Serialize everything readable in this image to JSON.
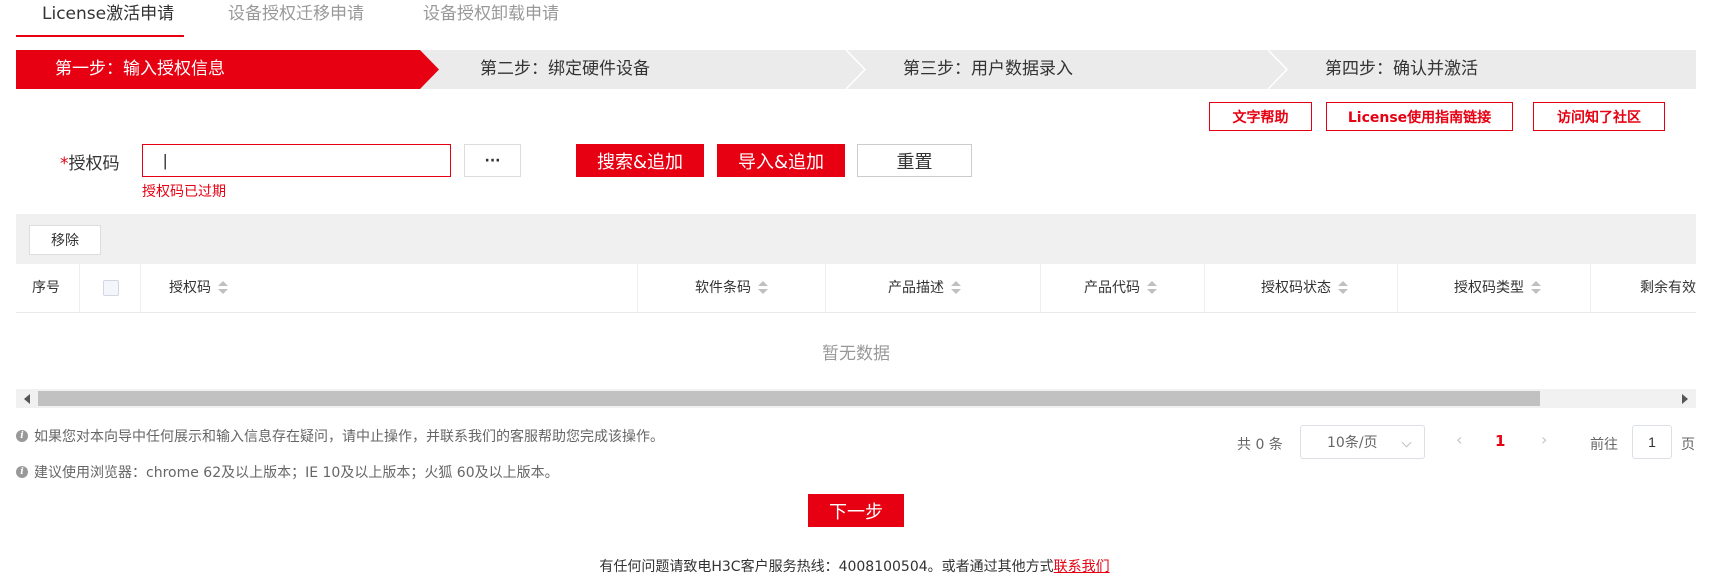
{
  "tabs": [
    {
      "label": "License激活申请",
      "active": true
    },
    {
      "label": "设备授权迁移申请",
      "active": false
    },
    {
      "label": "设备授权卸载申请",
      "active": false
    }
  ],
  "steps": [
    {
      "label": "第一步：输入授权信息",
      "active": true
    },
    {
      "label": "第二步：绑定硬件设备",
      "active": false
    },
    {
      "label": "第三步：用户数据录入",
      "active": false
    },
    {
      "label": "第四步：确认并激活",
      "active": false
    }
  ],
  "help_links": {
    "text_help": "文字帮助",
    "license_guide": "License使用指南链接",
    "community": "访问知了社区"
  },
  "form": {
    "required_mark": "*",
    "auth_code_label": "授权码",
    "auth_code_value": "|",
    "more_button": "···",
    "search_add": "搜索&追加",
    "import_add": "导入&追加",
    "reset": "重置",
    "error_text": "授权码已过期"
  },
  "table": {
    "remove_button": "移除",
    "columns": [
      "序号",
      "授权码",
      "软件条码",
      "产品描述",
      "产品代码",
      "授权码状态",
      "授权码类型",
      "剩余有效"
    ],
    "empty_text": "暂无数据"
  },
  "notes": [
    "如果您对本向导中任何展示和输入信息存在疑问，请中止操作，并联系我们的客服帮助您完成该操作。",
    "建议使用浏览器：chrome 62及以上版本；IE 10及以上版本；火狐 60及以上版本。"
  ],
  "pagination": {
    "total": "共 0 条",
    "page_size": "10条/页",
    "prev": "‹",
    "current_page": "1",
    "next": "›",
    "goto_label": "前往",
    "goto_value": "1",
    "page_suffix": "页"
  },
  "next_step": "下一步",
  "footer": {
    "text": "有任何问题请致电H3C客户服务热线：4008100504。或者通过其他方式",
    "link": "联系我们"
  },
  "colors": {
    "accent": "#e60012",
    "step_bg": "#ebebeb"
  }
}
